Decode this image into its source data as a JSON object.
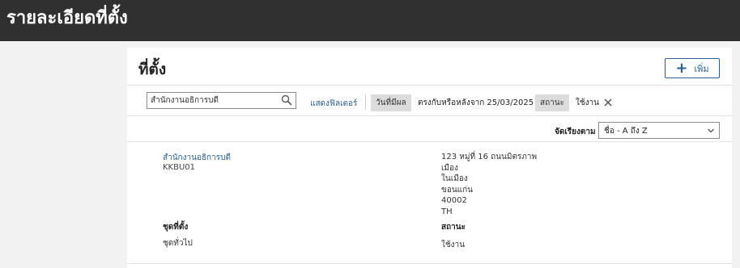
{
  "header": {
    "title": "รายละเอียดที่ตั้ง"
  },
  "main": {
    "title": "ที่ตั้ง",
    "add_button": {
      "label": "เพิ่ม",
      "icon": "plus-icon"
    }
  },
  "filters": {
    "search": {
      "value": "สำนักงานอธิการบดี",
      "placeholder": ""
    },
    "show_filters_label": "แสดงฟิลเตอร์",
    "effective_date": {
      "label": "วันที่มีผล",
      "value": "ตรงกับหรือหลังจาก 25/03/2025"
    },
    "status": {
      "label": "สถานะ",
      "value": "ใช้งาน"
    }
  },
  "sort": {
    "label": "จัดเรียงตาม",
    "value": "ชื่อ - A ถึง Z"
  },
  "location": {
    "name": "สำนักงานอธิการบดี",
    "code": "KKBU01",
    "address": [
      "123 หมู่ที่ 16 ถนนมิตรภาพ",
      "เมือง",
      "ในเมือง",
      "ขอนแก่น",
      "40002",
      "TH"
    ],
    "set_label": "ชุดที่ตั้ง",
    "set_value": "ชุดทั่วไป",
    "status_label": "สถานะ",
    "status_value": "ใช้งาน"
  },
  "colors": {
    "header_bg": "#303030",
    "accent": "#2a5d8f",
    "chip_bg": "#dcdcdc"
  }
}
